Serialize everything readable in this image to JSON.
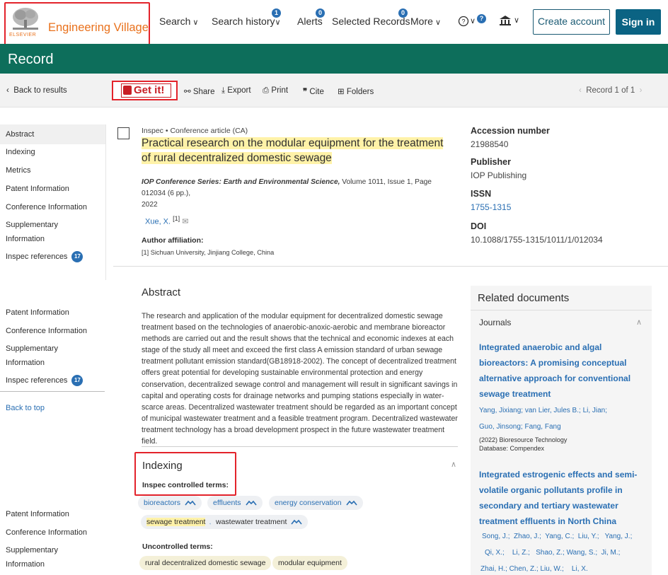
{
  "header": {
    "logo_text": "Engineering Village",
    "publisher_mark": "ELSEVIER",
    "nav": [
      {
        "label": "Search"
      },
      {
        "label": "Search history",
        "badge": "1"
      },
      {
        "label": "Alerts",
        "badge": "0"
      },
      {
        "label": "Selected Records",
        "badge": "0"
      },
      {
        "label": "More"
      }
    ],
    "help_badge": "?",
    "create_account": "Create account",
    "sign_in": "Sign in"
  },
  "record_bar": {
    "title": "Record"
  },
  "toolbar": {
    "back": "Back to results",
    "get_it": "Get it!",
    "share": "Share",
    "export": "Export",
    "print": "Print",
    "cite": "Cite",
    "folders": "Folders",
    "pager": "Record 1 of 1"
  },
  "left_nav": {
    "group1": [
      "Abstract",
      "Indexing",
      "Metrics",
      "Patent Information",
      "Conference Information",
      "Supplementary",
      "Information"
    ],
    "inspec_refs": "Inspec references",
    "refs_count": "17",
    "group2": [
      "Patent Information",
      "Conference Information",
      "Supplementary",
      "Information"
    ],
    "back_to_top": "Back to top",
    "group3": [
      "Patent Information",
      "Conference Information",
      "Supplementary",
      "Information"
    ]
  },
  "record": {
    "source_line": "Inspec  •  Conference article (CA)",
    "title_line1": "Practical research on the modular equipment for the treatment",
    "title_line2": "of rural decentralized domestic sewage",
    "journal": "IOP Conference Series: Earth and Environmental Science,",
    "journal_details": " Volume 1011, Issue 1, Page 012034 (6 pp.),",
    "year": "2022",
    "author": "Xue, X.",
    "author_ref": "[1]",
    "affiliation_label": "Author affiliation:",
    "affiliation": "[1] Sichuan University, Jinjiang College, China"
  },
  "metadata": {
    "accession_label": "Accession number",
    "accession": "21988540",
    "publisher_label": "Publisher",
    "publisher": "IOP Publishing",
    "issn_label": "ISSN",
    "issn": "1755-1315",
    "doi_label": "DOI",
    "doi": "10.1088/1755-1315/1011/1/012034"
  },
  "abstract": {
    "heading": "Abstract",
    "text": "The research and application of the modular equipment for decentralized domestic sewage treatment based on the technologies of anaerobic-anoxic-aerobic and membrane bioreactor methods are carried out and the result shows that the technical and economic indexes at each stage of the study all meet and exceed the first class A emission standard of urban sewage treatment pollutant emission standard(GB18918-2002). The concept of decentralized treatment offers great potential for developing sustainable environmental protection and energy conservation, decentralized sewage control and management will result in significant savings in capital and operating costs for drainage networks and pumping stations especially in water-scarce areas. Decentralized wastewater treatment should be regarded as an important concept of municipal wastewater treatment and a feasible treatment program. Decentralized wastewater treatment technology has a broad development prospect in the future wastewater treatment field."
  },
  "indexing": {
    "heading": "Indexing",
    "controlled_label": "Inspec controlled terms:",
    "controlled": [
      "bioreactors",
      "effluents",
      "energy conservation",
      "sewage treatment",
      "wastewater treatment"
    ],
    "uncontrolled_label": "Uncontrolled terms:",
    "uncontrolled": [
      "rural decentralized domestic sewage",
      "modular equipment"
    ]
  },
  "related": {
    "heading": "Related documents",
    "section": "Journals",
    "docs": [
      {
        "title": "Integrated anaerobic and algal bioreactors: A promising conceptual alternative approach for conventional sewage treatment",
        "authors_line1": "Yang, Jixiang; van Lier, Jules B.;  Li, Jian;",
        "authors_line2": "Guo, Jinsong; Fang, Fang",
        "source": "(2022) Bioresource Technology",
        "database": "Database: Compendex"
      },
      {
        "title": "Integrated estrogenic effects and semi-volatile organic pollutants profile in secondary and tertiary wastewater treatment effluents in North China",
        "authors_line1": "Song, J.;  Zhao, J.;  Yang, C.;  Liu, Y.;   Yang, J.;",
        "authors_line2": "Qi, X.;    Li, Z.;   Shao, Z.; Wang, S.;  Ji, M.;",
        "authors_line3": "Zhai, H.; Chen, Z.; Liu, W.;    Li, X."
      }
    ]
  },
  "colors": {
    "brand_orange": "#e9711c",
    "record_bar": "#0d6e5b",
    "link_blue": "#2a6fb3",
    "highlight": "#fff2a8",
    "annotation_red": "#e3232b"
  }
}
